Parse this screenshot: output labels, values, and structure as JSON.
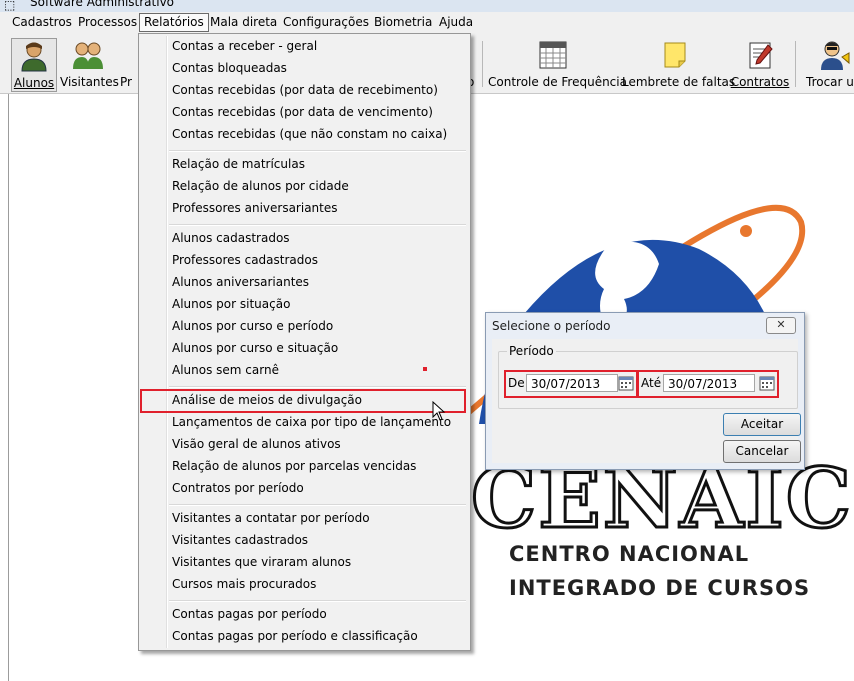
{
  "window": {
    "title": "Software Administrativo"
  },
  "menubar": [
    {
      "label": "Cadastros"
    },
    {
      "label": "Processos"
    },
    {
      "label": "Relatórios"
    },
    {
      "label": "Mala direta"
    },
    {
      "label": "Configurações"
    },
    {
      "label": "Biometria"
    },
    {
      "label": "Ajuda"
    }
  ],
  "toolbar": {
    "alunos": "Alunos",
    "visitantes": "Visitantes",
    "partial_left": "Pr",
    "partial_mid": "o",
    "controle": "Controle de Frequência",
    "lembrete": "Lembrete de faltas",
    "contratos": "Contratos",
    "trocar": "Trocar us"
  },
  "menu": {
    "items": [
      "Contas a receber - geral",
      "Contas bloqueadas",
      "Contas recebidas (por data de recebimento)",
      "Contas recebidas (por data de vencimento)",
      "Contas recebidas (que não constam no caixa)",
      "Relação de matrículas",
      "Relação de alunos por cidade",
      "Professores aniversariantes",
      "Alunos cadastrados",
      "Professores cadastrados",
      "Alunos aniversariantes",
      "Alunos por situação",
      "Alunos por curso e período",
      "Alunos por curso e situação",
      "Alunos sem carnê",
      "Análise de meios de divulgação",
      "Lançamentos de caixa por tipo de lançamento",
      "Visão geral de alunos ativos",
      "Relação de alunos por parcelas vencidas",
      "Contratos por período",
      "Visitantes a contatar por período",
      "Visitantes cadastrados",
      "Visitantes que viraram alunos",
      "Cursos mais procurados",
      "Contas pagas por período",
      "Contas pagas por período e classificação"
    ]
  },
  "dialog": {
    "title": "Selecione o período",
    "close": "✕",
    "group": "Período",
    "de_label": "De",
    "de_value": "30/07/2013",
    "ate_label": "Até",
    "ate_value": "30/07/2013",
    "ok": "Aceitar",
    "cancel": "Cancelar"
  },
  "logo": {
    "brand": "CENAIC",
    "line1": "CENTRO NACIONAL",
    "line2": "INTEGRADO DE CURSOS"
  },
  "colors": {
    "highlight": "#e0202c",
    "globe": "#1f4fa8",
    "orbit": "#e8772e"
  }
}
